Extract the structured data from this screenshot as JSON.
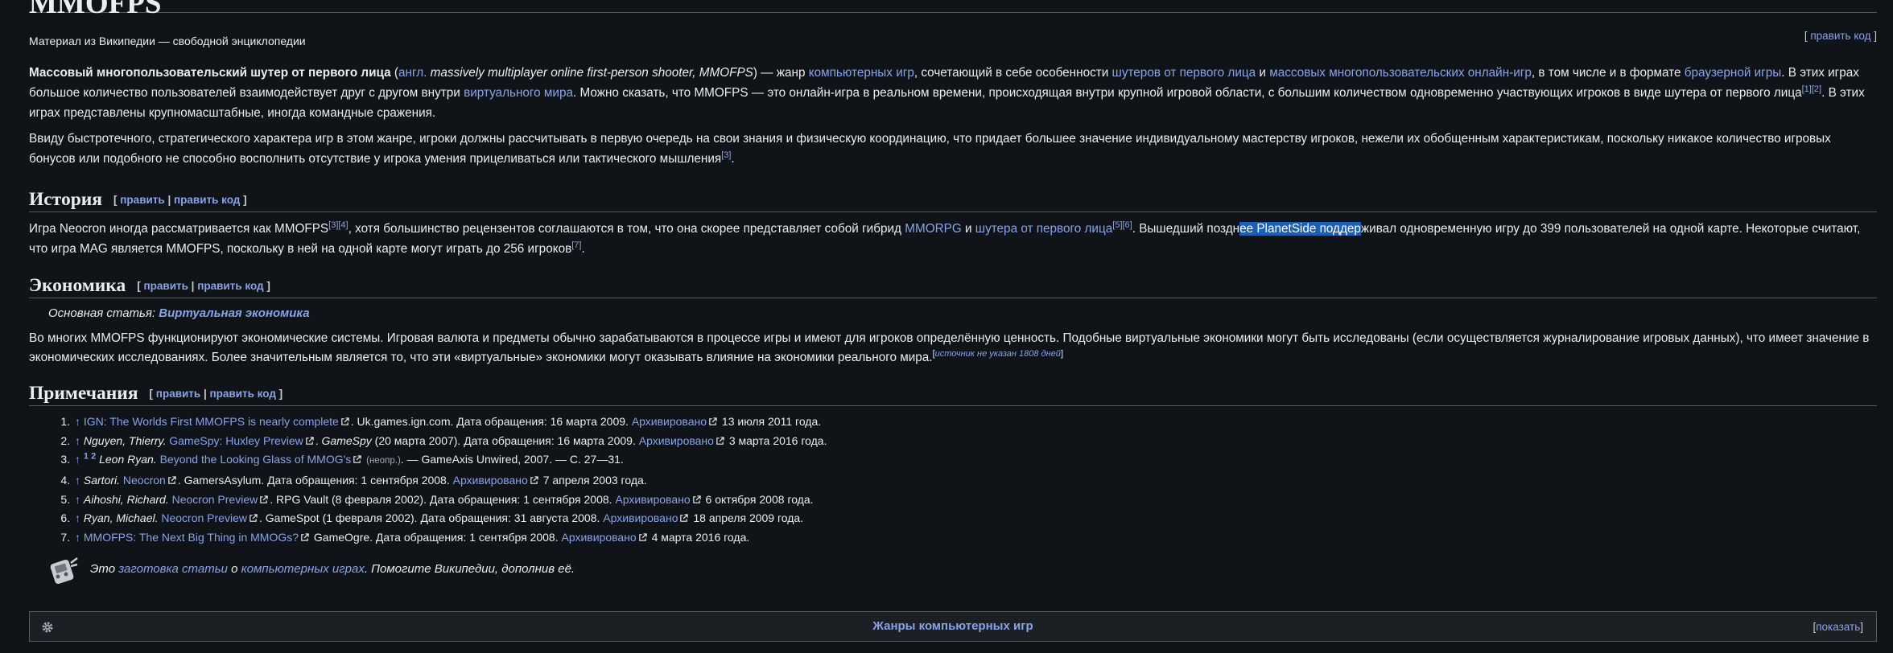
{
  "page": {
    "title": "MMOFPS",
    "from": "Материал из Википедии — свободной энциклопедии",
    "edit_code": "править код"
  },
  "intro": {
    "p1": {
      "bold": "Массовый многопользовательский шутер от первого лица",
      "t1": " (",
      "lang": "англ.",
      "italic": " massively multiplayer online first-person shooter, MMOFPS",
      "t2": ") — жанр ",
      "l1": "компьютерных игр",
      "t3": ", сочетающий в себе особенности ",
      "l2": "шутеров от первого лица",
      "t4": " и ",
      "l3": "массовых многопользовательских онлайн-игр",
      "t5": ", в том числе и в формате ",
      "l4": "браузерной игры",
      "t6": ". В этих играх большое количество пользователей взаимодействует друг с другом внутри ",
      "l5": "виртуального мира",
      "t7": ". Можно сказать, что MMOFPS — это онлайн-игра в реальном времени, происходящая внутри крупной игровой области, с большим количеством одновременно участвующих игроков в виде шутера от первого лица",
      "r1": "[1]",
      "r2": "[2]",
      "t8": ". В этих играх представлены крупномасштабные, иногда командные сражения."
    },
    "p2": {
      "text": "Ввиду быстротечного, стратегического характера игр в этом жанре, игроки должны рассчитывать в первую очередь на свои знания и физическую координацию, что придает большее значение индивидуальному мастерству игроков, нежели их обобщенным характеристикам, поскольку никакое количество игровых бонусов или подобного не способно восполнить отсутствие у игрока умения прицеливаться или тактического мышления",
      "r3": "[3]",
      "end": "."
    }
  },
  "edit": {
    "edit": "править",
    "sep": " | ",
    "edit_code": "править код",
    "lb": "[ ",
    "rb": " ]"
  },
  "history": {
    "heading": "История",
    "t1": "Игра Neocron иногда рассматривается как MMOFPS",
    "r3": "[3]",
    "r4": "[4]",
    "t2": ", хотя большинство рецензентов соглашаются в том, что она скорее представляет собой гибрид ",
    "l1": "MMORPG",
    "t3": " и ",
    "l2": "шутера от первого лица",
    "r5": "[5]",
    "r6": "[6]",
    "t4": ". Вышедший поздн",
    "hl": "ее PlanetSide поддер",
    "t5": "живал одновременную игру до 399 пользователей на одной карте. Некоторые считают, что игра MAG является MMOFPS, поскольку в ней на одной карте могут играть до 256 игроков",
    "r7": "[7]",
    "end": "."
  },
  "economy": {
    "heading": "Экономика",
    "hatnote_label": "Основная статья: ",
    "hatnote_link": "Виртуальная экономика",
    "text": "Во многих MMOFPS функционируют экономические системы. Игровая валюта и предметы обычно зарабатываются в процессе игры и имеют для игроков определённую ценность. Подобные виртуальные экономики могут быть исследованы (если осуществляется журналирование игровых данных), что имеет значение в экономических исследованиях. Более значительным является то, что эти «виртуальные» экономики могут оказывать влияние на экономики реального мира.",
    "cn_lb": "[",
    "cn": "источник не указан 1808 дней",
    "cn_rb": "]"
  },
  "notes": {
    "heading": "Примечания",
    "arrow": "↑",
    "items": [
      {
        "link": "IGN: The Worlds First MMOFPS is nearly complete",
        "rest": ". Uk.games.ign.com. Дата обращения: 16 марта 2009. ",
        "archive": "Архивировано",
        "tail": " 13 июля 2011 года."
      },
      {
        "author": "Nguyen, Thierry.",
        "link": "GameSpy: Huxley Preview",
        "rest": ". ",
        "pub": "GameSpy",
        "rest2": " (20 марта 2007). Дата обращения: 16 марта 2009. ",
        "archive": "Архивировано",
        "tail": " 3 марта 2016 года."
      },
      {
        "supa": "1",
        "supb": "2",
        "author": "Leon Ryan.",
        "link": "Beyond the Looking Glass of MMOG's",
        "small": "(неопр.)",
        "rest": ". — GameAxis Unwired, 2007. — С. 27—31."
      },
      {
        "author": "Sartori.",
        "link": "Neocron",
        "rest": ". GamersAsylum. Дата обращения: 1 сентября 2008. ",
        "archive": "Архивировано",
        "tail": " 7 апреля 2003 года."
      },
      {
        "author": "Aihoshi, Richard.",
        "link": "Neocron Preview",
        "rest": ". RPG Vault (8 февраля 2002). Дата обращения: 1 сентября 2008. ",
        "archive": "Архивировано",
        "tail": " 6 октября 2008 года."
      },
      {
        "author": "Ryan, Michael.",
        "link": "Neocron Preview",
        "rest": ". GameSpot (1 февраля 2002). Дата обращения: 31 августа 2008. ",
        "archive": "Архивировано",
        "tail": " 18 апреля 2009 года."
      },
      {
        "link": "MMOFPS: The Next Big Thing in MMOGs?",
        "rest": " GameOgre. Дата обращения: 1 сентября 2008. ",
        "archive": "Архивировано",
        "tail": " 4 марта 2016 года."
      }
    ]
  },
  "stub": {
    "t1": "Это ",
    "l1": "заготовка статьи",
    "t2": " о ",
    "l2": "компьютерных играх",
    "t3": ". Помогите Википедии, дополнив её."
  },
  "navbox": {
    "title": "Жанры компьютерных игр",
    "lb": "[",
    "show": "показать",
    "rb": "]"
  }
}
